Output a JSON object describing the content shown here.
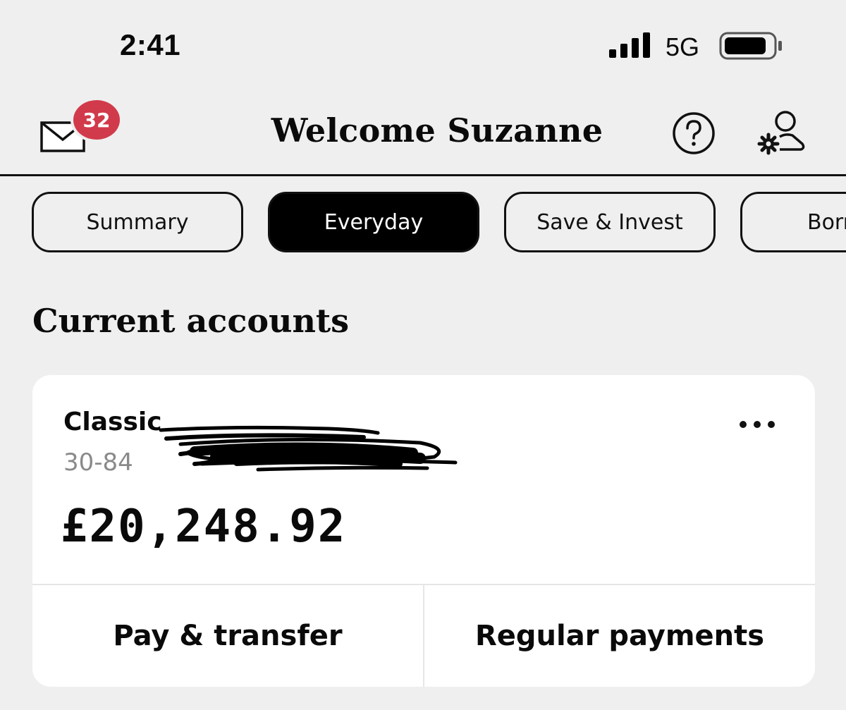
{
  "status_bar": {
    "time": "2:41",
    "network": "5G",
    "icons": [
      "signal-icon",
      "battery-icon"
    ]
  },
  "header": {
    "title": "Welcome Suzanne",
    "mail_badge_count": "32",
    "icons": [
      "mail-icon",
      "help-icon",
      "profile-settings-icon"
    ],
    "badge_color": "#d13a4a"
  },
  "tabs": [
    {
      "label": "Summary",
      "active": false
    },
    {
      "label": "Everyday",
      "active": true
    },
    {
      "label": "Save & Invest",
      "active": false
    },
    {
      "label": "Borr",
      "active": false
    }
  ],
  "section": {
    "title": "Current accounts"
  },
  "account": {
    "name": "Classic",
    "sort_code_partial": "30-84",
    "balance": "£20,248.92",
    "actions": [
      {
        "label": "Pay & transfer"
      },
      {
        "label": "Regular payments"
      }
    ]
  },
  "colors": {
    "background": "#efefef",
    "card": "#ffffff",
    "active_tab": "#000000"
  }
}
